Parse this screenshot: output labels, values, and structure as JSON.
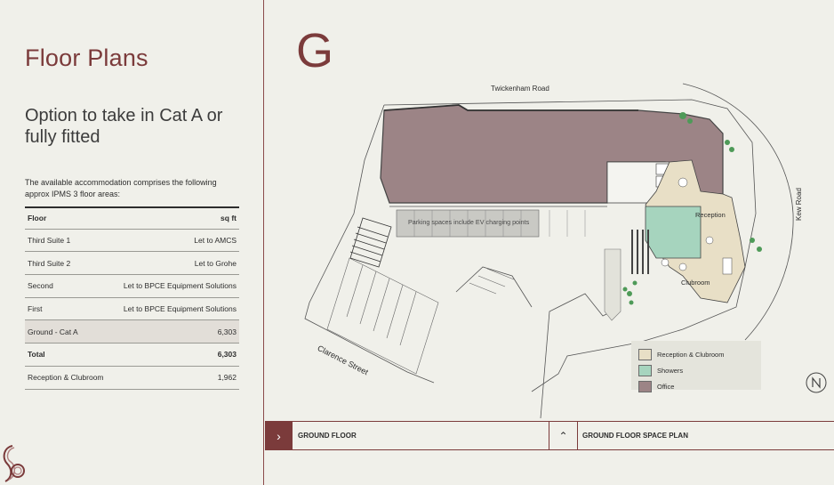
{
  "left": {
    "title": "Floor Plans",
    "subtitle": "Option to take in Cat A or fully fitted",
    "intro": "The available accommodation comprises the following approx IPMS 3 floor areas:",
    "table": {
      "header": {
        "floor": "Floor",
        "area": "sq ft"
      },
      "rows": [
        {
          "floor": "Third Suite 1",
          "area": "Let to AMCS"
        },
        {
          "floor": "Third Suite 2",
          "area": "Let to Grohe"
        },
        {
          "floor": "Second",
          "area": "Let to  BPCE  Equipment Solutions"
        },
        {
          "floor": "First",
          "area": "Let to  BPCE  Equipment Solutions"
        },
        {
          "floor": "Ground - Cat A",
          "area": "6,303"
        },
        {
          "floor": "Total",
          "area": "6,303"
        },
        {
          "floor": "Reception & Clubroom",
          "area": "1,962"
        }
      ]
    }
  },
  "plan": {
    "floor_letter": "G",
    "road_top": "Twickenham Road",
    "road_right": "Kew Road",
    "road_street": "Clarence Street",
    "parking_note": "Parking spaces include EV charging points",
    "label_reception": "Reception",
    "label_clubroom": "Clubroom",
    "legend": [
      {
        "label": "Reception & Clubroom",
        "color": "#e8dfc6"
      },
      {
        "label": "Showers",
        "color": "#a6d4be"
      },
      {
        "label": "Office",
        "color": "#9c8486"
      }
    ]
  },
  "nav": {
    "ground_floor": "GROUND FLOOR",
    "space_plan": "GROUND FLOOR SPACE PLAN",
    "next_icon": "chevron-right-icon",
    "up_icon": "chevron-up-icon"
  },
  "colors": {
    "accent": "#7b3b3b",
    "office": "#9c8486",
    "reception": "#e8dfc6",
    "showers": "#a6d4be",
    "background": "#f0f0ea"
  }
}
